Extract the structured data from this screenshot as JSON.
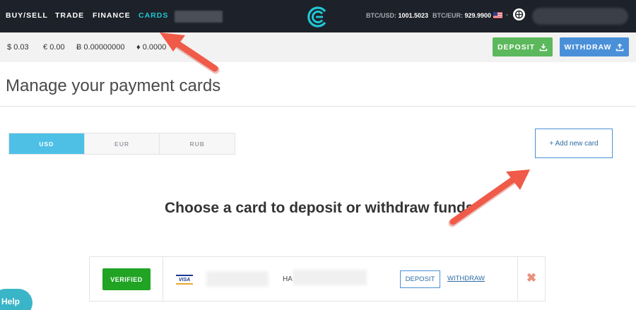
{
  "nav": {
    "items": [
      {
        "label": "BUY/SELL",
        "active": false
      },
      {
        "label": "TRADE",
        "active": false
      },
      {
        "label": "FINANCE",
        "active": false
      },
      {
        "label": "CARDS",
        "active": true
      }
    ],
    "rates": [
      {
        "label": "BTC/USD:",
        "value": "1001.5023"
      },
      {
        "label": "BTC/EUR:",
        "value": "929.9900"
      }
    ],
    "flag_caret": "⌄"
  },
  "balances": [
    {
      "symbol": "$",
      "value": "0.03"
    },
    {
      "symbol": "€",
      "value": "0.00"
    },
    {
      "symbol": "Ƀ",
      "value": "0.00000000"
    },
    {
      "symbol": "♦",
      "value": "0.0000"
    }
  ],
  "actions": {
    "deposit": "DEPOSIT",
    "withdraw": "WITHDRAW"
  },
  "page": {
    "title": "Manage your payment cards",
    "heading": "Choose a card to deposit or withdraw funds",
    "add_card": "+ Add new card"
  },
  "currency_tabs": [
    {
      "label": "USD",
      "active": true
    },
    {
      "label": "EUR",
      "active": false
    },
    {
      "label": "RUB",
      "active": false
    }
  ],
  "card": {
    "status": "VERIFIED",
    "brand": "VISA",
    "name_prefix": "HA",
    "deposit": "DEPOSIT",
    "withdraw": "WITHDRAW",
    "remove_glyph": "✖"
  },
  "help": "Help",
  "colors": {
    "nav_bg": "#1d2129",
    "accent": "#1ec8d6",
    "deposit_green": "#5cb85c",
    "withdraw_blue": "#4a90d9",
    "tab_active": "#4ec0e6",
    "verified_green": "#21a324",
    "annotation_arrow": "#f05a48"
  }
}
